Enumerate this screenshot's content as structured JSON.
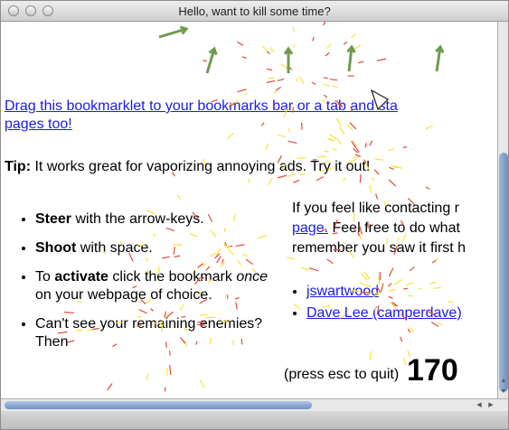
{
  "window": {
    "title": "Hello, want to kill some time?"
  },
  "page": {
    "bookmarklet_link": "Drag this bookmarklet to your bookmarks bar or a tab and sta",
    "bookmarklet_link_2": "pages too!",
    "tip_label": "Tip:",
    "tip_text": " It works great for vaporizing annoying ads. Try it out!",
    "features": [
      {
        "bold": "Steer",
        "text": " with the arrow-keys."
      },
      {
        "bold": "Shoot",
        "text": " with space."
      },
      {
        "pre": "To ",
        "bold": "activate",
        "mid": " click the bookmark ",
        "italic": "once",
        "post": " on your webpage of choice."
      },
      {
        "text": "Can't see your remaining enemies? Then"
      }
    ],
    "contact_line1": "If you feel like contacting r",
    "contact_link": "page.",
    "contact_line2_rest": " Feel free to do what",
    "contact_line3": "remember you saw it first h",
    "contacts": [
      {
        "label": "jswartwood"
      },
      {
        "label": "Dave Lee (camperdave)"
      }
    ],
    "quit_hint": "(press esc to quit)",
    "score": "170"
  },
  "colors": {
    "link": "#1a1aee",
    "projectile": "#6e9a4f",
    "particle_yellow": "#f7e33a",
    "particle_red": "#e04a3a"
  },
  "icons": {
    "ship": "triangle-ship-icon",
    "scroll_up": "up-arrow-icon",
    "scroll_down": "down-arrow-icon",
    "scroll_left": "left-arrow-icon",
    "scroll_right": "right-arrow-icon"
  }
}
